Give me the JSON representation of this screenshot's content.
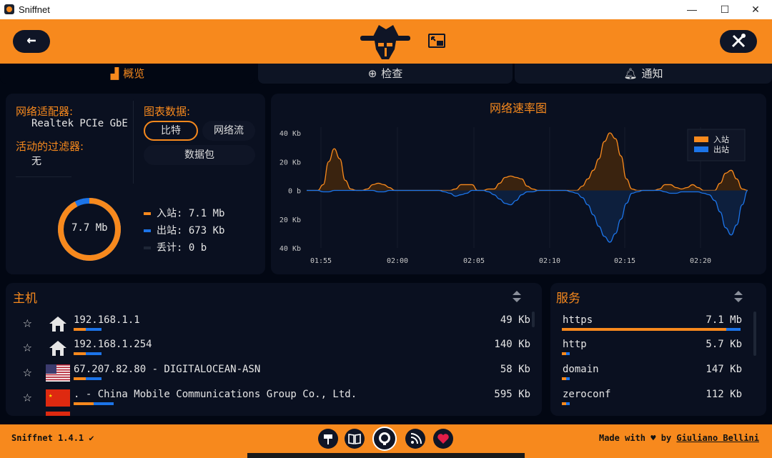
{
  "window": {
    "title": "Sniffnet",
    "minimize": "—",
    "maximize": "☐",
    "close": "✕"
  },
  "topbar": {
    "back_label": "←"
  },
  "tabs": [
    {
      "label": "概览"
    },
    {
      "label": "检查"
    },
    {
      "label": "通知"
    }
  ],
  "overview": {
    "adapter_label": "网络适配器:",
    "adapter_value": "Realtek PCIe GbE F",
    "filter_label": "活动的过滤器:",
    "filter_value": "无",
    "chart_data_label": "图表数据:",
    "chart_data_options": [
      "比特",
      "网络流",
      "数据包"
    ],
    "selected_option": "比特",
    "total_label": "7.7 Mb",
    "incoming_text": "入站: 7.1 Mb",
    "outgoing_text": "出站: 673 Kb",
    "dropped_text": "丢计: 0 b",
    "colors": {
      "incoming": "#f7891d",
      "outgoing": "#1c74e8",
      "dropped": "#1e2636"
    },
    "incoming_fraction": 0.922
  },
  "chart_data": {
    "type": "area",
    "title": "网络速率图",
    "x_ticks": [
      "01:55",
      "02:00",
      "02:05",
      "02:10",
      "02:15",
      "02:20"
    ],
    "y_ticks_labels": [
      "40 Kb",
      "20 Kb",
      "0 b",
      "20 Kb",
      "40 Kb"
    ],
    "ylim": [
      -40,
      40
    ],
    "legend_position": "top-right",
    "series": [
      {
        "name": "入站",
        "color": "#f7891d",
        "values": [
          0,
          0,
          0,
          4,
          20,
          29,
          22,
          7,
          1,
          0,
          0,
          1,
          4,
          5,
          4,
          2,
          0,
          0,
          0,
          0,
          0,
          0,
          0,
          0,
          0,
          0,
          0,
          1,
          4,
          4,
          4,
          0,
          0,
          1,
          1,
          5,
          9,
          10,
          9,
          8,
          3,
          1,
          0,
          0,
          0,
          0,
          0,
          0,
          0,
          0,
          3,
          8,
          14,
          22,
          34,
          40,
          36,
          24,
          8,
          1,
          0,
          0,
          0,
          0,
          1,
          4,
          4,
          2,
          1,
          2,
          4,
          2,
          0,
          0,
          0,
          5,
          12,
          14,
          8,
          1,
          0
        ]
      },
      {
        "name": "出站",
        "color": "#1c74e8",
        "values": [
          0,
          0,
          0,
          -1,
          -1,
          0,
          0,
          0,
          0,
          0,
          0,
          0,
          0,
          -1,
          -1,
          0,
          0,
          0,
          0,
          0,
          0,
          0,
          0,
          0,
          0,
          -1,
          -2,
          -4,
          -3,
          -2,
          0,
          0,
          0,
          -1,
          -3,
          -6,
          -9,
          -10,
          -7,
          -3,
          -1,
          -1,
          0,
          0,
          0,
          0,
          0,
          0,
          -1,
          -2,
          -5,
          -10,
          -17,
          -25,
          -32,
          -36,
          -30,
          -20,
          -9,
          -2,
          -1,
          0,
          0,
          0,
          0,
          -1,
          -2,
          -2,
          -1,
          -1,
          -1,
          -1,
          -2,
          -3,
          -7,
          -15,
          -26,
          -31,
          -24,
          -10,
          0
        ]
      }
    ]
  },
  "hosts": {
    "title": "主机",
    "rows": [
      {
        "name": "192.168.1.1",
        "bytes": "49 Kb",
        "flag": "home",
        "in_fraction": 0.03,
        "out_fraction": 0.04
      },
      {
        "name": "192.168.1.254",
        "bytes": "140 Kb",
        "flag": "home",
        "in_fraction": 0.03,
        "out_fraction": 0.04
      },
      {
        "name": "67.207.82.80 - DIGITALOCEAN-ASN",
        "bytes": "58 Kb",
        "flag": "us",
        "in_fraction": 0.03,
        "out_fraction": 0.04
      },
      {
        "name": ". - China Mobile Communications Group Co., Ltd.",
        "bytes": "595 Kb",
        "flag": "cn",
        "in_fraction": 0.05,
        "out_fraction": 0.05
      }
    ]
  },
  "services": {
    "title": "服务",
    "rows": [
      {
        "name": "https",
        "bytes": "7.1 Mb",
        "in_fraction": 0.92,
        "out_fraction": 0.08
      },
      {
        "name": "http",
        "bytes": "5.7 Kb",
        "in_fraction": 0.02,
        "out_fraction": 0.02
      },
      {
        "name": "domain",
        "bytes": "147 Kb",
        "in_fraction": 0.02,
        "out_fraction": 0.02
      },
      {
        "name": "zeroconf",
        "bytes": "112 Kb",
        "in_fraction": 0.02,
        "out_fraction": 0.02
      }
    ]
  },
  "footer": {
    "version": "Sniffnet 1.4.1",
    "made_with": "Made with",
    "by": "by",
    "author": "Giuliano Bellini"
  }
}
